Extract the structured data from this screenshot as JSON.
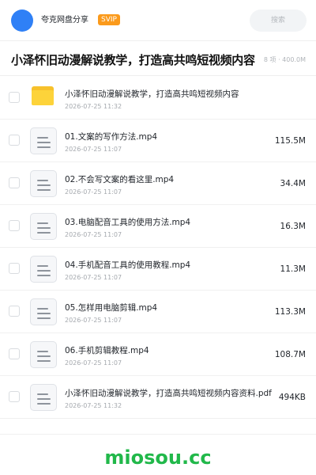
{
  "header": {
    "app_name": "夸克网盘分享",
    "vip_label": "SVIP",
    "search_placeholder": "搜索"
  },
  "folder": {
    "title": "小泽怀旧动漫解说教学，打造高共鸣短视频内容",
    "meta": "8 项 · 400.0M"
  },
  "files": [
    {
      "type": "folder",
      "name": "小泽怀旧动漫解说教学，打造高共鸣短视频内容",
      "date": "2026-07-25 11:32",
      "size": ""
    },
    {
      "type": "file",
      "name": "01.文案的写作方法.mp4",
      "date": "2026-07-25 11:07",
      "size": "115.5M"
    },
    {
      "type": "file",
      "name": "02.不会写文案的看这里.mp4",
      "date": "2026-07-25 11:07",
      "size": "34.4M"
    },
    {
      "type": "file",
      "name": "03.电脑配音工具的使用方法.mp4",
      "date": "2026-07-25 11:07",
      "size": "16.3M"
    },
    {
      "type": "file",
      "name": "04.手机配音工具的使用教程.mp4",
      "date": "2026-07-25 11:07",
      "size": "11.3M"
    },
    {
      "type": "file",
      "name": "05.怎样用电脑剪辑.mp4",
      "date": "2026-07-25 11:07",
      "size": "113.3M"
    },
    {
      "type": "file",
      "name": "06.手机剪辑教程.mp4",
      "date": "2026-07-25 11:07",
      "size": "108.7M"
    },
    {
      "type": "file",
      "name": "小泽怀旧动漫解说教学，打造高共鸣短视频内容资料.pdf",
      "date": "2026-07-25 11:32",
      "size": "494KB"
    }
  ],
  "watermark": "miosou.cc",
  "colors": {
    "accent": "#2f80f6",
    "vip": "#fb9a1b",
    "folder": "#fdd33a",
    "watermark": "#21b84a"
  }
}
